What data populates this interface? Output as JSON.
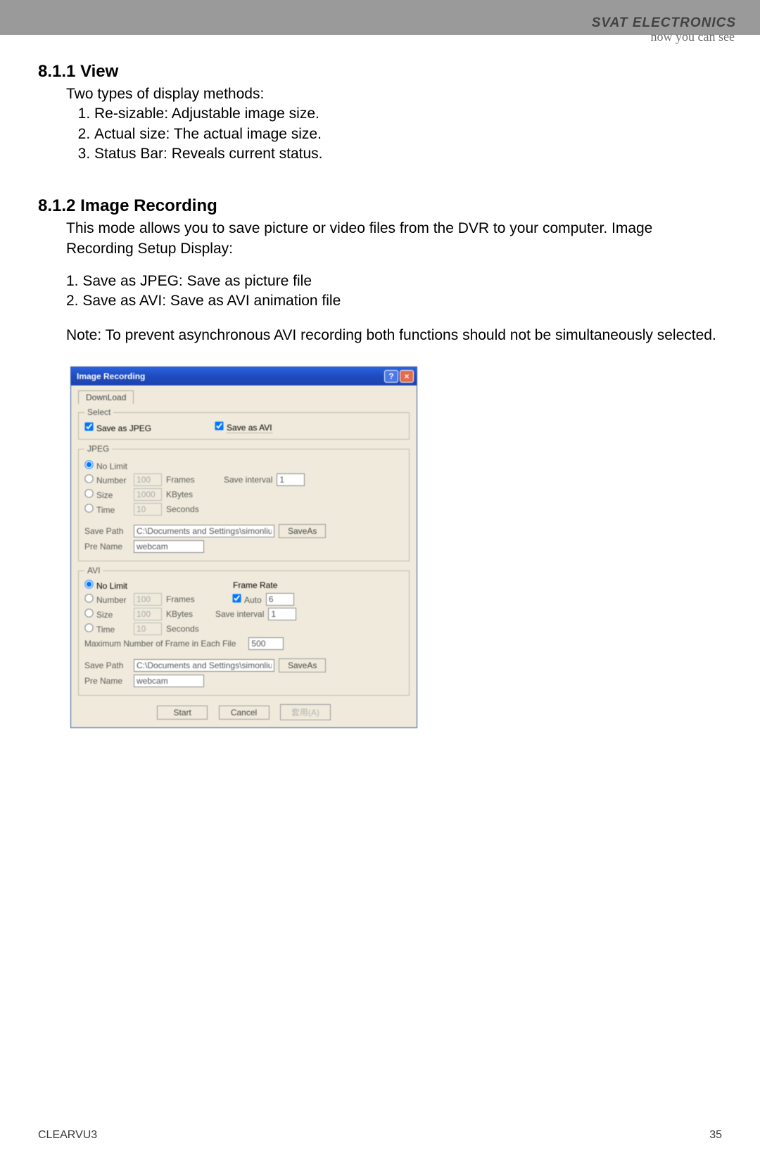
{
  "header": {
    "brand": "SVAT ELECTRONICS",
    "tagline": "now you can see"
  },
  "section_view": {
    "number": "8.1.1",
    "title": "View",
    "intro": "Two types of display methods:",
    "items": [
      "Re-sizable: Adjustable image size.",
      "Actual size: The actual image size.",
      "Status Bar: Reveals current status."
    ]
  },
  "section_rec": {
    "number": "8.1.2",
    "title": "Image Recording",
    "p1": "This mode allows you to save picture or video files from the DVR to your computer. Image Recording Setup Display:",
    "i1": "1. Save as JPEG: Save as picture file",
    "i2": "2. Save as AVI: Save as AVI animation file",
    "note": "Note: To prevent asynchronous AVI recording both functions should not be simultaneously selected."
  },
  "dialog": {
    "title": "Image Recording",
    "tab": "DownLoad",
    "select": {
      "legend": "Select",
      "jpeg": "Save as JPEG",
      "avi": "Save as AVI"
    },
    "jpeg": {
      "legend": "JPEG",
      "nolimit": "No Limit",
      "number": "Number",
      "number_val": "100",
      "frames": "Frames",
      "size": "Size",
      "size_val": "1000",
      "kbytes": "KBytes",
      "time": "Time",
      "time_val": "10",
      "seconds": "Seconds",
      "save_interval": "Save interval",
      "save_interval_val": "1",
      "save_path": "Save Path",
      "save_path_val": "C:\\Documents and Settings\\simonliu\\v",
      "saveas": "SaveAs",
      "prename": "Pre Name",
      "prename_val": "webcam"
    },
    "avi": {
      "legend": "AVI",
      "nolimit": "No Limit",
      "framerate": "Frame Rate",
      "number": "Number",
      "number_val": "100",
      "frames": "Frames",
      "auto": "Auto",
      "auto_val": "6",
      "size": "Size",
      "size_val": "100",
      "kbytes": "KBytes",
      "save_interval": "Save interval",
      "save_interval_val": "1",
      "time": "Time",
      "time_val": "10",
      "seconds": "Seconds",
      "maxframes": "Maximum Number of Frame in Each File",
      "maxframes_val": "500",
      "save_path": "Save Path",
      "save_path_val": "C:\\Documents and Settings\\simonliu\\v",
      "saveas": "SaveAs",
      "prename": "Pre Name",
      "prename_val": "webcam"
    },
    "buttons": {
      "start": "Start",
      "cancel": "Cancel",
      "apply": "套用(A)"
    }
  },
  "footer": {
    "left": "CLEARVU3",
    "right": "35"
  }
}
